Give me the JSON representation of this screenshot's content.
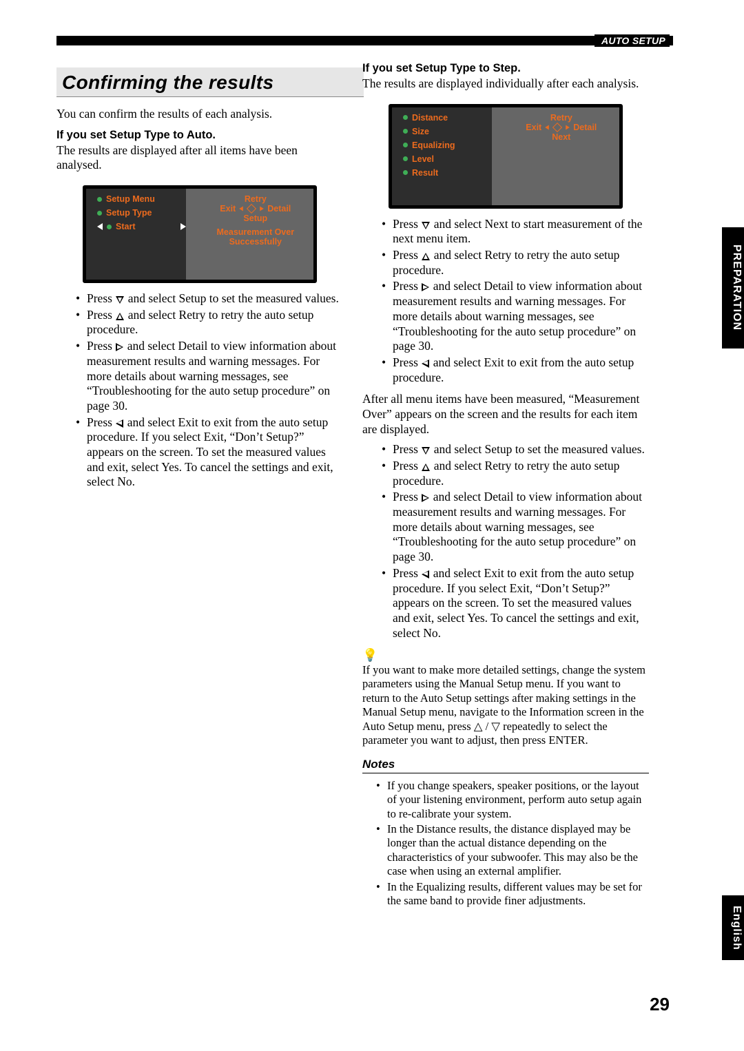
{
  "header": {
    "section": "AUTO SETUP"
  },
  "sidetabs": {
    "prep": "PREPARATION",
    "eng": "English"
  },
  "left": {
    "title": "Confirming the results",
    "intro": "You can confirm the results of each analysis.",
    "sub": "If you set Setup Type to Auto.",
    "sub_body": "The results are displayed after all items have been analysed.",
    "osd": {
      "items": [
        "Setup Menu",
        "Setup Type",
        "Start"
      ],
      "r1": "Retry",
      "r2a": "Exit",
      "r2b": "Detail",
      "r3": "Setup",
      "r4": "Measurement Over",
      "r5": "Successfully"
    },
    "bullets": [
      {
        "dir": "down",
        "txt": " and select Setup to set the measured values."
      },
      {
        "dir": "up",
        "txt": " and select Retry to retry the auto setup procedure."
      },
      {
        "dir": "right",
        "txt": " and select Detail to view information about measurement results and warning messages. For more details about warning messages, see “Troubleshooting for the auto setup procedure” on page 30."
      },
      {
        "dir": "left",
        "txt": " and select Exit to exit from the auto setup procedure. If you select Exit, “Don’t Setup?” appears on the screen. To set the measured values and exit, select Yes. To cancel the settings and exit, select No."
      }
    ]
  },
  "right": {
    "sub": "If you set Setup Type to Step.",
    "sub_body": "The results are displayed individually after each analysis.",
    "osd": {
      "items": [
        "Distance",
        "Size",
        "Equalizing",
        "Level",
        "Result"
      ],
      "r1": "Retry",
      "r2a": "Exit",
      "r2b": "Detail",
      "r3": "Next"
    },
    "bullets1": [
      {
        "dir": "down",
        "txt": " and select Next to start measurement of the next menu item."
      },
      {
        "dir": "up",
        "txt": " and select Retry to retry the auto setup procedure."
      },
      {
        "dir": "right",
        "txt": " and select Detail to view information about measurement results and warning messages. For more details about warning messages, see “Troubleshooting for the auto setup procedure” on page 30."
      },
      {
        "dir": "left",
        "txt": " and select Exit to exit from the auto setup procedure."
      }
    ],
    "after": "After all menu items have been measured, “Measurement Over” appears on the screen and the results for each item are displayed.",
    "bullets2": [
      {
        "dir": "down",
        "txt": " and select Setup to set the measured values."
      },
      {
        "dir": "up",
        "txt": " and select Retry to retry the auto setup procedure."
      },
      {
        "dir": "right",
        "txt": " and select Detail to view information about measurement results and warning messages. For more details about warning messages, see “Troubleshooting for the auto setup procedure” on page 30."
      },
      {
        "dir": "left",
        "txt": " and select Exit to exit from the auto setup procedure. If you select Exit, “Don’t Setup?” appears on the screen. To set the measured values and exit, select Yes. To cancel the settings and exit, select No."
      }
    ],
    "tip": "If you want to make more detailed settings, change the system parameters using the Manual Setup menu. If you want to return to the Auto Setup settings after making settings in the Manual Setup menu, navigate to the Information screen in the Auto Setup menu, press △ / ▽ repeatedly to select the parameter you want to adjust, then press ENTER.",
    "notes_hd": "Notes",
    "notes": [
      "If you change speakers, speaker positions, or the layout of your listening environment, perform auto setup again to re-calibrate your system.",
      "In the Distance results, the distance displayed may be longer than the actual distance depending on the characteristics of your subwoofer. This may also be the case when using an external amplifier.",
      "In the Equalizing results, different values may be set for the same band to provide finer adjustments."
    ]
  },
  "press": "Press ",
  "pagenum": "29"
}
